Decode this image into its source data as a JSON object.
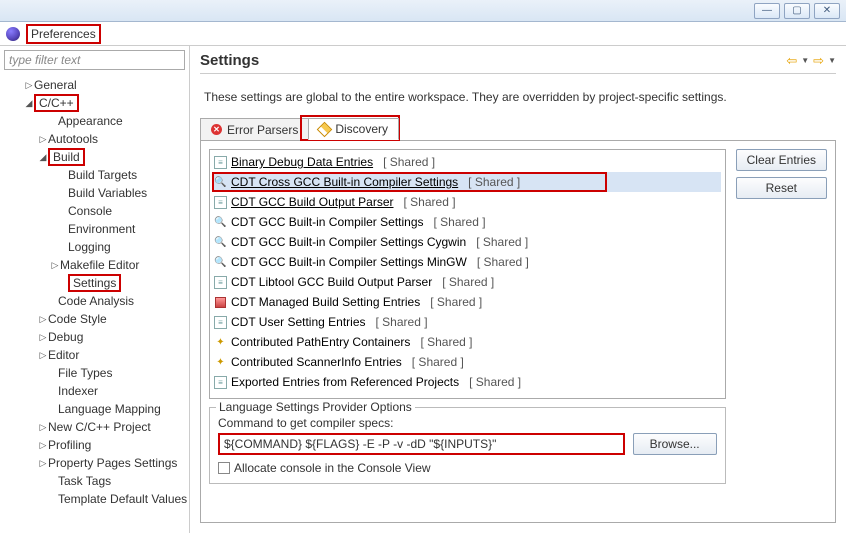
{
  "window": {
    "title": "Preferences",
    "filter_placeholder": "type filter text"
  },
  "tree": [
    {
      "label": "General",
      "pad": 24,
      "tw": "▷"
    },
    {
      "label": "C/C++",
      "pad": 24,
      "tw": "◢",
      "hl": true
    },
    {
      "label": "Appearance",
      "pad": 48,
      "tw": ""
    },
    {
      "label": "Autotools",
      "pad": 38,
      "tw": "▷"
    },
    {
      "label": "Build",
      "pad": 38,
      "tw": "◢",
      "hl": true
    },
    {
      "label": "Build Targets",
      "pad": 58,
      "tw": ""
    },
    {
      "label": "Build Variables",
      "pad": 58,
      "tw": ""
    },
    {
      "label": "Console",
      "pad": 58,
      "tw": ""
    },
    {
      "label": "Environment",
      "pad": 58,
      "tw": ""
    },
    {
      "label": "Logging",
      "pad": 58,
      "tw": ""
    },
    {
      "label": "Makefile Editor",
      "pad": 50,
      "tw": "▷"
    },
    {
      "label": "Settings",
      "pad": 58,
      "tw": "",
      "hl": true
    },
    {
      "label": "Code Analysis",
      "pad": 48,
      "tw": ""
    },
    {
      "label": "Code Style",
      "pad": 38,
      "tw": "▷"
    },
    {
      "label": "Debug",
      "pad": 38,
      "tw": "▷"
    },
    {
      "label": "Editor",
      "pad": 38,
      "tw": "▷"
    },
    {
      "label": "File Types",
      "pad": 48,
      "tw": ""
    },
    {
      "label": "Indexer",
      "pad": 48,
      "tw": ""
    },
    {
      "label": "Language Mapping",
      "pad": 48,
      "tw": ""
    },
    {
      "label": "New C/C++ Project",
      "pad": 38,
      "tw": "▷"
    },
    {
      "label": "Profiling",
      "pad": 38,
      "tw": "▷"
    },
    {
      "label": "Property Pages Settings",
      "pad": 38,
      "tw": "▷"
    },
    {
      "label": "Task Tags",
      "pad": 48,
      "tw": ""
    },
    {
      "label": "Template Default Values",
      "pad": 48,
      "tw": ""
    }
  ],
  "page": {
    "heading": "Settings",
    "description": "These settings are global to the entire workspace.  They are overridden by project-specific settings.",
    "tabs": {
      "error_parsers": "Error Parsers",
      "discovery": "Discovery"
    },
    "buttons": {
      "clear": "Clear Entries",
      "reset": "Reset",
      "browse": "Browse..."
    },
    "group_title": "Language Settings Provider Options",
    "cmd_label": "Command to get compiler specs:",
    "cmd_value": "${COMMAND} ${FLAGS} -E -P -v -dD \"${INPUTS}\"",
    "allocate": "Allocate console in the Console View"
  },
  "providers": [
    {
      "icon": "doc",
      "label": "Binary Debug Data Entries",
      "share": "[ Shared ]",
      "ul": true
    },
    {
      "icon": "mag",
      "label": "CDT Cross GCC Built-in Compiler Settings",
      "share": "[ Shared ]",
      "ul": true,
      "selected": true
    },
    {
      "icon": "doc",
      "label": "CDT GCC Build Output Parser",
      "share": "[ Shared ]",
      "ul": true
    },
    {
      "icon": "mag",
      "label": "CDT GCC Built-in Compiler Settings",
      "share": "[ Shared ]"
    },
    {
      "icon": "mag",
      "label": "CDT GCC Built-in Compiler Settings Cygwin",
      "share": "[ Shared ]"
    },
    {
      "icon": "mag",
      "label": "CDT GCC Built-in Compiler Settings MinGW",
      "share": "[ Shared ]"
    },
    {
      "icon": "doc",
      "label": "CDT Libtool GCC Build Output Parser",
      "share": "[ Shared ]"
    },
    {
      "icon": "blk",
      "label": "CDT Managed Build Setting Entries",
      "share": "[ Shared ]"
    },
    {
      "icon": "doc",
      "label": "CDT User Setting Entries",
      "share": "[ Shared ]"
    },
    {
      "icon": "key",
      "label": "Contributed PathEntry Containers",
      "share": "[ Shared ]"
    },
    {
      "icon": "key",
      "label": "Contributed ScannerInfo Entries",
      "share": "[ Shared ]"
    },
    {
      "icon": "doc",
      "label": "Exported Entries from Referenced Projects",
      "share": "[ Shared ]"
    }
  ]
}
